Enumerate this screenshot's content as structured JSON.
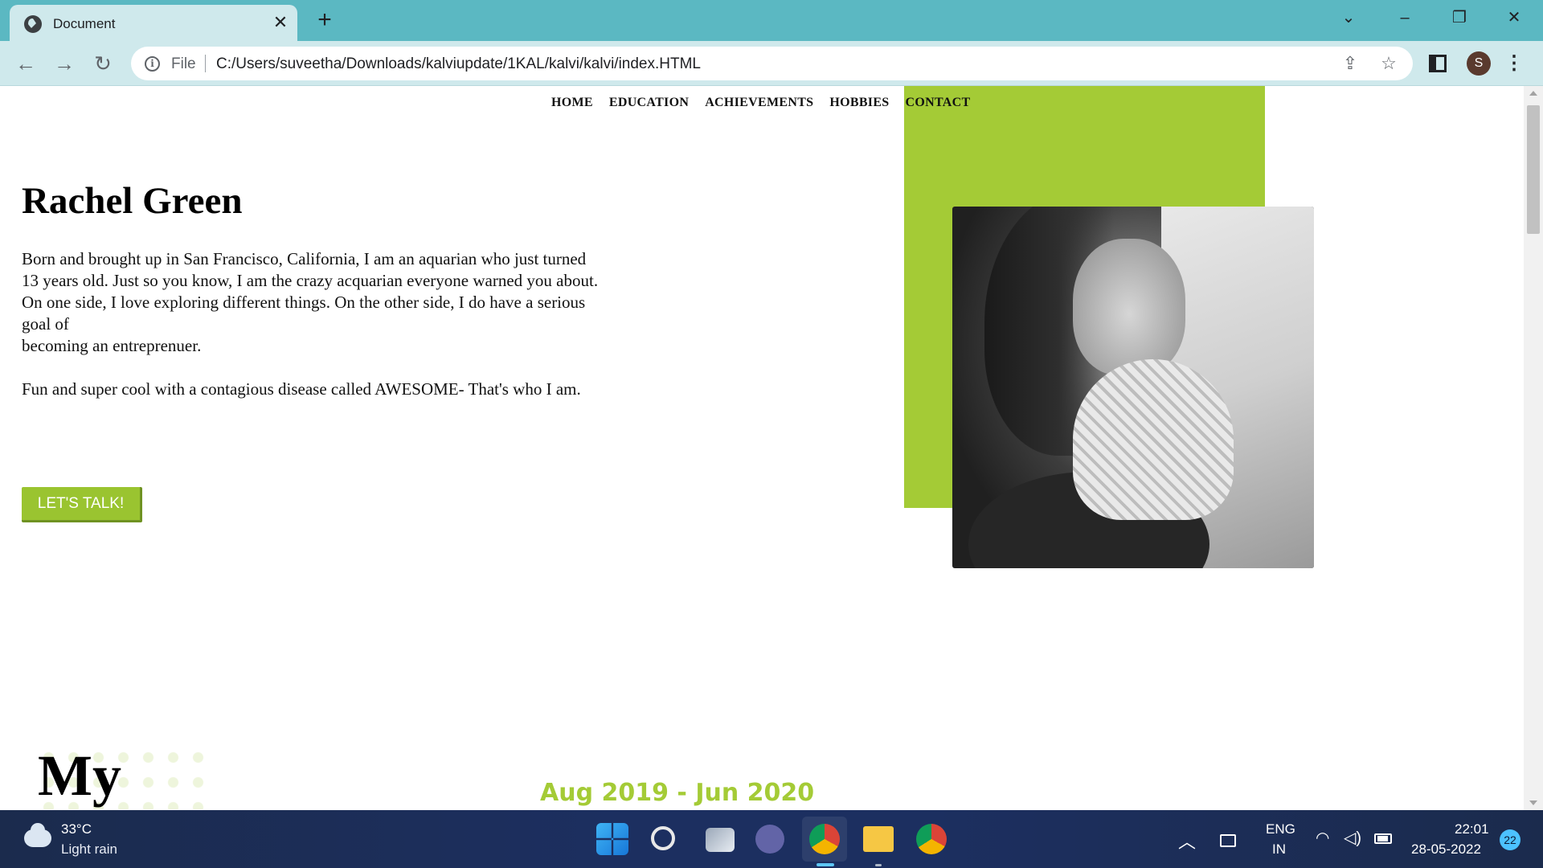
{
  "browser": {
    "tab_title": "Document",
    "tab_close": "✕",
    "new_tab": "+",
    "address": {
      "security_label": "File",
      "url": "C:/Users/suveetha/Downloads/kalviupdate/1KAL/kalvi/kalvi/index.HTML"
    },
    "profile_initial": "S",
    "window_controls": {
      "tab_search": "⌄",
      "minimize": "–",
      "restore": "❐",
      "close": "✕"
    }
  },
  "page": {
    "nav": [
      "HOME",
      "EDUCATION",
      "ACHIEVEMENTS",
      "HOBBIES",
      "CONTACT"
    ],
    "hero": {
      "name": "Rachel Green",
      "bio_lines": [
        "Born and brought up in San Francisco, California, I am an aquarian who just turned",
        "13 years old. Just so you know, I am the crazy acquarian everyone warned you about.",
        "On one side, I love exploring different things. On the other side, I do have a serious",
        "goal of",
        "becoming an entreprenuer."
      ],
      "tagline": "Fun and super cool with a contagious disease called AWESOME- That's who I am.",
      "cta_label": "LET'S TALK!"
    },
    "section_title": "My",
    "timeline_date": "Aug 2019 - Jun 2020",
    "colors": {
      "accent": "#a4cb36",
      "button": "#9ac430"
    }
  },
  "taskbar": {
    "weather": {
      "temp": "33°C",
      "condition": "Light rain"
    },
    "tray": {
      "lang_line1": "ENG",
      "lang_line2": "IN",
      "time": "22:01",
      "date": "28-05-2022",
      "notifications": "22"
    }
  }
}
